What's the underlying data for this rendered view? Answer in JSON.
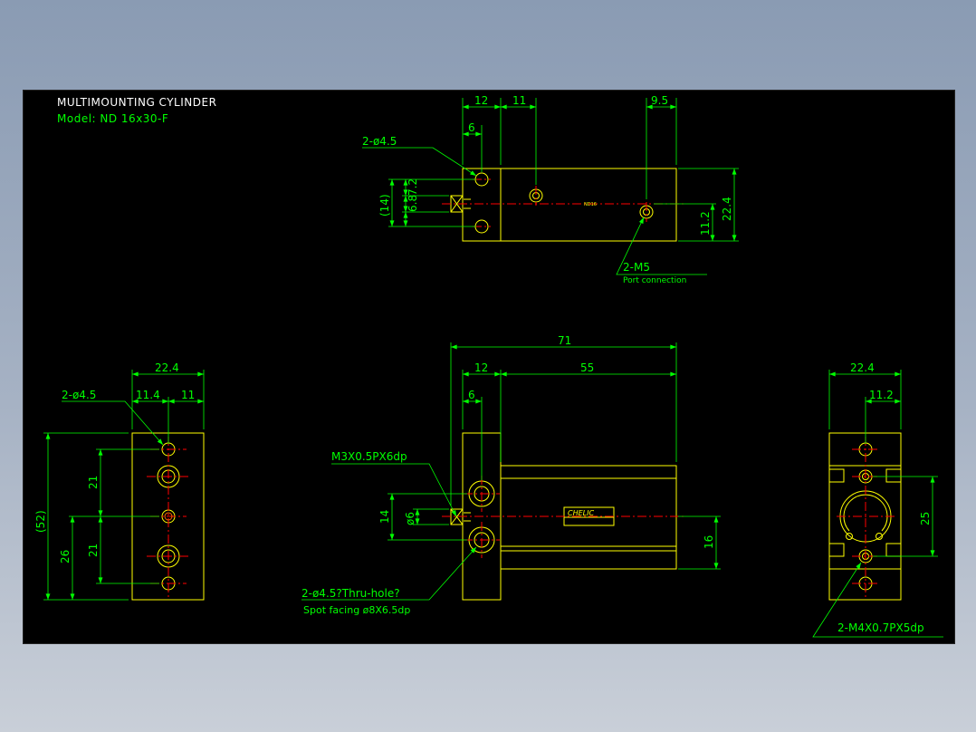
{
  "drawing": {
    "title": "MULTIMOUNTING CYLINDER",
    "model": "Model: ND 16x30-F"
  },
  "colors": {
    "background": "#000000",
    "outline": "#ffff00",
    "dimension": "#00ff00",
    "centerline": "#ff0000",
    "frame": "#8a9bb3"
  },
  "top_view": {
    "dim_12": "12",
    "dim_11": "11",
    "dim_9_5": "9.5",
    "dim_6": "6",
    "dim_14": "(14)",
    "dim_6_8": "6.8",
    "dim_7_2": "7.2",
    "dim_11_2": "11.2",
    "dim_22_4": "22.4",
    "hole_callout": "2-ø4.5",
    "port_callout": "2-M5",
    "port_note": "Port connection",
    "body_tag": "ND16"
  },
  "left_view": {
    "dim_22_4": "22.4",
    "dim_11_4": "11.4",
    "dim_11": "11",
    "dim_52": "(52)",
    "dim_26": "26",
    "dim_21_upper": "21",
    "dim_21_lower": "21",
    "hole_callout": "2-ø4.5"
  },
  "front_view": {
    "dim_71": "71",
    "dim_12": "12",
    "dim_55": "55",
    "dim_6": "6",
    "dim_14": "14",
    "dim_phi6": "ø6",
    "dim_16": "16",
    "thread_callout": "M3X0.5PX6dp",
    "hole_callout": "2-ø4.5?Thru-hole?",
    "spot_facing": "Spot facing  ø8X6.5dp",
    "brand_label": "CHELIC"
  },
  "right_view": {
    "dim_22_4": "22.4",
    "dim_11_2": "11.2",
    "dim_25": "25",
    "thread_callout": "2-M4X0.7PX5dp"
  }
}
